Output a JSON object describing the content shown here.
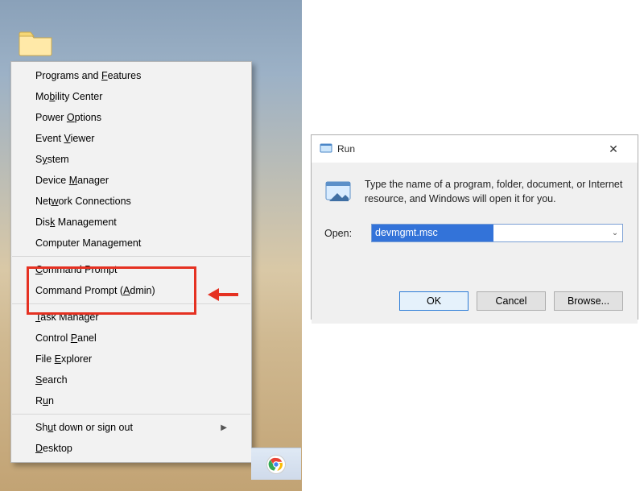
{
  "desktop": {
    "folder_label": ""
  },
  "context_menu": {
    "items": [
      {
        "label_pre": "Programs and ",
        "key": "F",
        "label_post": "eatures"
      },
      {
        "label_pre": "Mo",
        "key": "b",
        "label_post": "ility Center"
      },
      {
        "label_pre": "Power ",
        "key": "O",
        "label_post": "ptions"
      },
      {
        "label_pre": "Event ",
        "key": "V",
        "label_post": "iewer"
      },
      {
        "label_pre": "S",
        "key": "y",
        "label_post": "stem"
      },
      {
        "label_pre": "Device ",
        "key": "M",
        "label_post": "anager"
      },
      {
        "label_pre": "Net",
        "key": "w",
        "label_post": "ork Connections"
      },
      {
        "label_pre": "Dis",
        "key": "k",
        "label_post": " Management"
      },
      {
        "label_pre": "Computer Mana",
        "key": "g",
        "label_post": "ement"
      },
      {
        "label_pre": "",
        "key": "C",
        "label_post": "ommand Prompt"
      },
      {
        "label_pre": "Command Prompt (",
        "key": "A",
        "label_post": "dmin)"
      },
      {
        "label_pre": "",
        "key": "T",
        "label_post": "ask Manager"
      },
      {
        "label_pre": "Control ",
        "key": "P",
        "label_post": "anel"
      },
      {
        "label_pre": "File ",
        "key": "E",
        "label_post": "xplorer"
      },
      {
        "label_pre": "",
        "key": "S",
        "label_post": "earch"
      },
      {
        "label_pre": "R",
        "key": "u",
        "label_post": "n"
      },
      {
        "label_pre": "Sh",
        "key": "u",
        "label_post": "t down or sign out",
        "submenu": true
      },
      {
        "label_pre": "",
        "key": "D",
        "label_post": "esktop"
      }
    ]
  },
  "run_dialog": {
    "title": "Run",
    "close": "✕",
    "description": "Type the name of a program, folder, document, or Internet resource, and Windows will open it for you.",
    "open_label": "Open:",
    "input_value": "devmgmt.msc",
    "buttons": {
      "ok": "OK",
      "cancel": "Cancel",
      "browse": "Browse..."
    }
  },
  "taskbar": {
    "chrome": "Google Chrome"
  }
}
